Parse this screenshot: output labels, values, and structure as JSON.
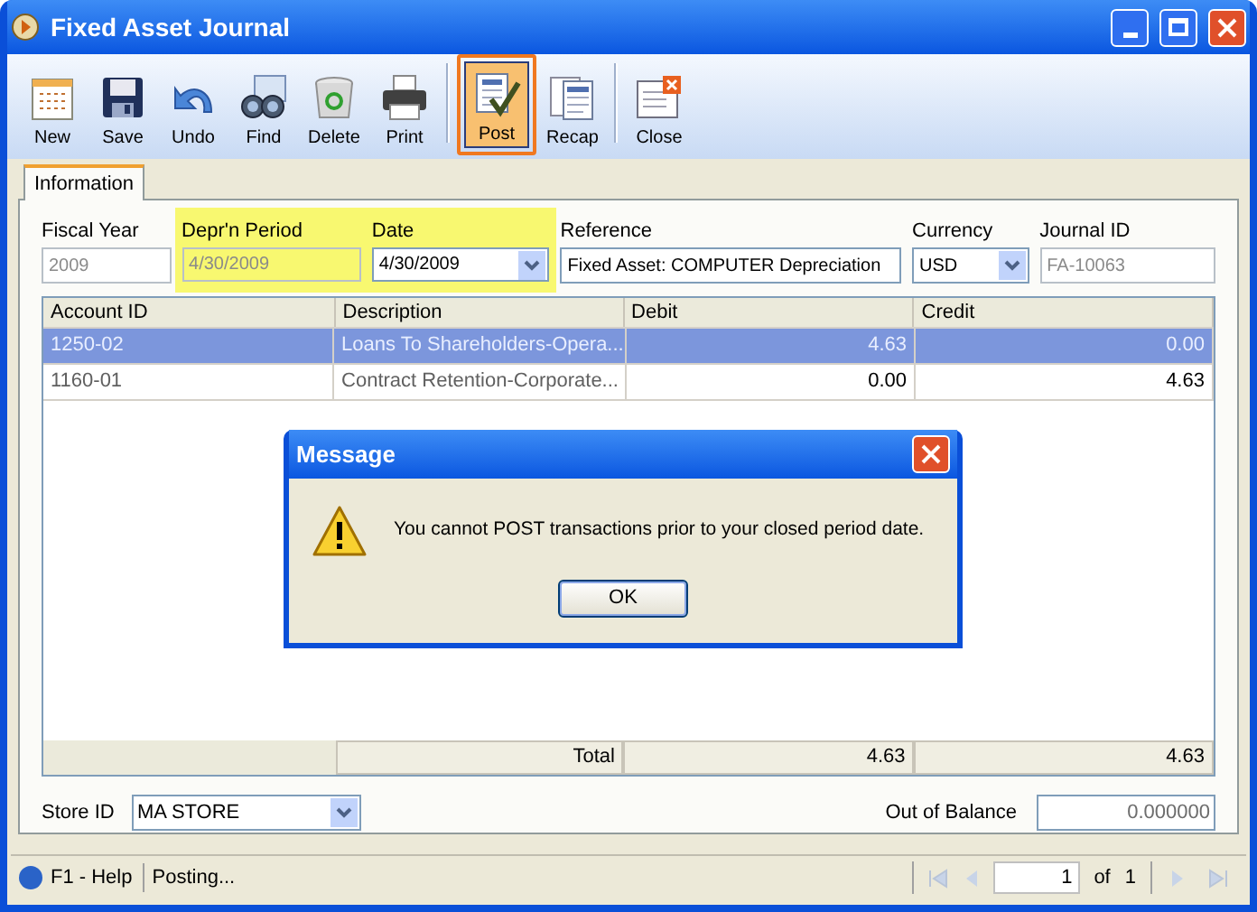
{
  "window": {
    "title": "Fixed Asset Journal"
  },
  "toolbar": [
    {
      "label": "New",
      "kind": "new",
      "selected": false
    },
    {
      "label": "Save",
      "kind": "save",
      "selected": false
    },
    {
      "label": "Undo",
      "kind": "undo",
      "selected": false
    },
    {
      "label": "Find",
      "kind": "find",
      "selected": false
    },
    {
      "label": "Delete",
      "kind": "delete",
      "selected": false
    },
    {
      "label": "Print",
      "kind": "print",
      "selected": false
    },
    {
      "label": "Post",
      "kind": "post",
      "selected": true
    },
    {
      "label": "Recap",
      "kind": "recap",
      "selected": false
    },
    {
      "label": "Close",
      "kind": "close",
      "selected": false
    }
  ],
  "tabs": [
    {
      "label": "Information",
      "selected": true
    }
  ],
  "fields": [
    {
      "label": "Fiscal Year",
      "value": "2009",
      "kind": "text",
      "disabled": true,
      "highlighted": false
    },
    {
      "label": "Depr'n Period",
      "value": "4/30/2009",
      "kind": "text",
      "disabled": true,
      "highlighted": true
    },
    {
      "label": "Date",
      "value": "4/30/2009",
      "kind": "dropdown",
      "disabled": false,
      "highlighted": true
    },
    {
      "label": "Reference",
      "value": "Fixed Asset: COMPUTER Depreciation",
      "kind": "text",
      "disabled": false,
      "highlighted": false
    },
    {
      "label": "Currency",
      "value": "USD",
      "kind": "dropdown",
      "disabled": false,
      "highlighted": false
    },
    {
      "label": "Journal ID",
      "value": "FA-10063",
      "kind": "text",
      "disabled": true,
      "highlighted": false
    }
  ],
  "table": {
    "columns": [
      "Account ID",
      "Description",
      "Debit",
      "Credit"
    ],
    "rows": [
      {
        "cells": [
          "1250-02",
          "Loans To Shareholders-Opera...",
          "4.63",
          "0.00"
        ],
        "selected": true
      },
      {
        "cells": [
          "1160-01",
          "Contract Retention-Corporate...",
          "0.00",
          "4.63"
        ],
        "selected": false
      }
    ],
    "totals": [
      "Total",
      "4.63",
      "4.63"
    ]
  },
  "store": {
    "label": "Store ID",
    "value": "MA STORE"
  },
  "out_of_balance": {
    "label": "Out of Balance",
    "value": "0.000000"
  },
  "dialog": {
    "title": "Message",
    "message": "You cannot POST transactions prior to your closed period date.",
    "button": "OK"
  },
  "status_bar": {
    "help": "F1 - Help",
    "status": "Posting...",
    "page": "1",
    "of": "of",
    "total": "1"
  }
}
